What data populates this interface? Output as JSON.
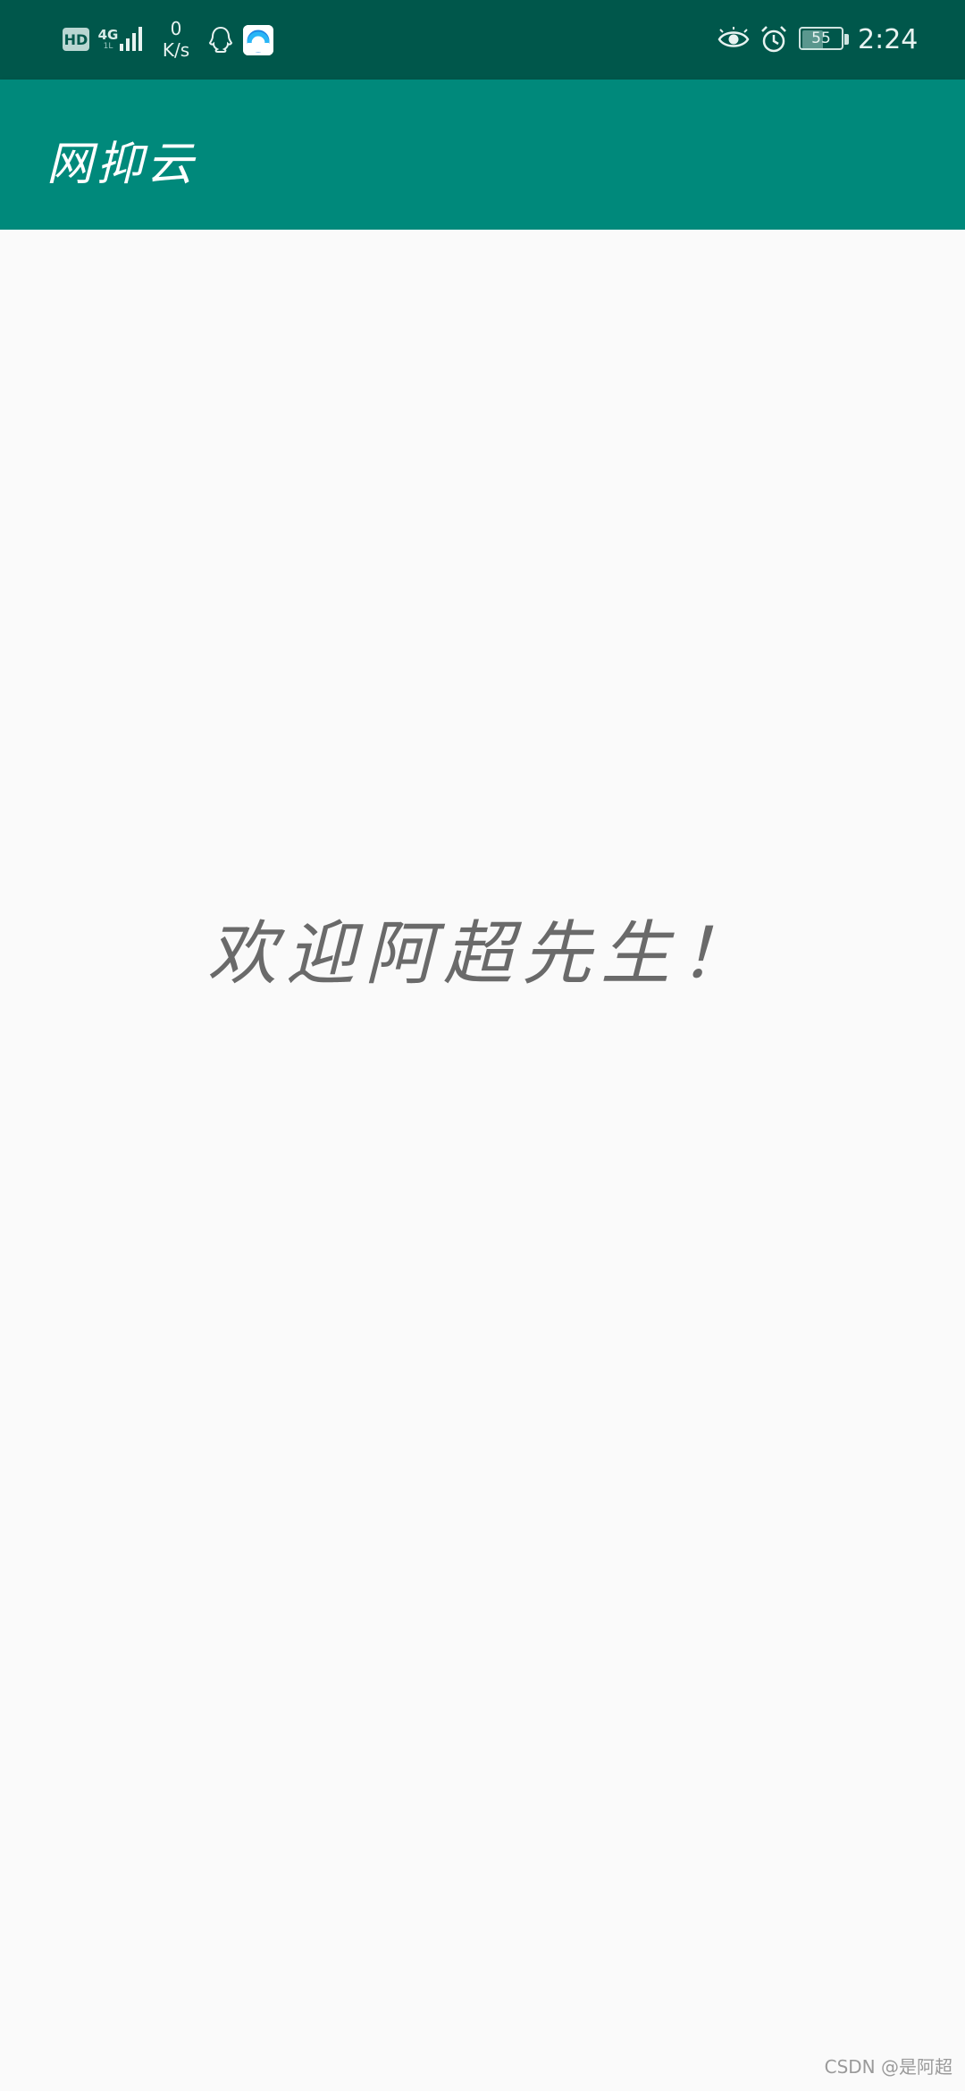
{
  "status_bar": {
    "hd_label": "HD",
    "network_type": "4G",
    "network_sub": "1L",
    "speed_value": "0",
    "speed_unit": "K/s",
    "battery_level": "55",
    "battery_fraction": 0.55,
    "time": "2:24",
    "icons": [
      "hd-icon",
      "signal-icon",
      "qq-icon",
      "app-icon",
      "eye-icon",
      "alarm-icon",
      "battery-icon"
    ]
  },
  "app_bar": {
    "title": "网抑云",
    "color": "#00897b"
  },
  "main": {
    "welcome_text": "欢迎阿超先生！"
  },
  "watermark": "CSDN @是阿超",
  "colors": {
    "status_bar": "#00574b",
    "app_bar": "#00897b",
    "background": "#fafafa",
    "welcome_text": "#6a6a6a"
  }
}
